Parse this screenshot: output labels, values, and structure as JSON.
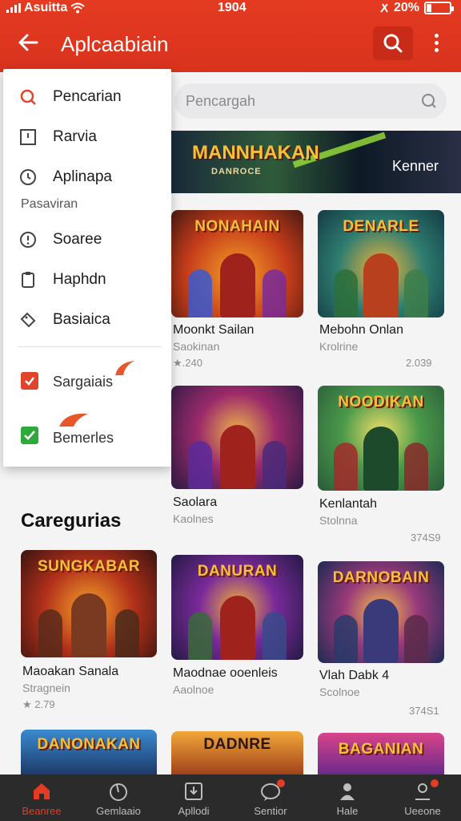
{
  "status": {
    "carrier": "Asuitta",
    "time": "1904",
    "battery": "20%",
    "battery_level": 0.2
  },
  "appbar": {
    "title": "Aplcaabiain"
  },
  "search": {
    "placeholder": "Pencargah"
  },
  "banner": {
    "title": "MANNHAKAN",
    "subtitle": "DANROCE",
    "tag": "Kenner"
  },
  "menu": {
    "items": [
      {
        "label": "Pencarian",
        "icon": "search-icon"
      },
      {
        "label": "Rarvia",
        "icon": "window-icon"
      },
      {
        "label": "Aplinapa",
        "icon": "clock-icon"
      },
      {
        "label": "Soaree",
        "icon": "info-icon"
      },
      {
        "label": "Haphdn",
        "icon": "clipboard-icon"
      },
      {
        "label": "Basiaica",
        "icon": "tag-icon"
      }
    ],
    "header": "Pasaviran",
    "checks": [
      {
        "label": "Sargaiais",
        "checked": false,
        "color": "#e0452c"
      },
      {
        "label": "Bemerles",
        "checked": true,
        "color": "#2eaa3c"
      }
    ]
  },
  "games_row1": [
    {
      "title": "NONAHAIN",
      "name": "Moonkt Sailan",
      "sub": "Saokinan",
      "rating": "★.240",
      "side": ""
    },
    {
      "title": "DENARLE",
      "name": "Mebohn Onlan",
      "sub": "Krolrine",
      "rating": "",
      "side": "2.039"
    }
  ],
  "games_row2": [
    {
      "title": "",
      "name": "Saolara",
      "sub": "Kaolnes",
      "rating": "",
      "side": ""
    },
    {
      "title": "NOODIKAN",
      "name": "Kenlantah",
      "sub": "Stolnna",
      "rating": "",
      "side": "374S9"
    }
  ],
  "categories": {
    "title": "Caregurias",
    "items": [
      {
        "title": "SUNGKABAR",
        "name": "Maoakan Sanala",
        "sub": "Stragnein",
        "rating": "★ 2.79",
        "side": ""
      },
      {
        "title": "DANURAN",
        "name": "Maodnae ooenleis",
        "sub": "Aaolnoe",
        "rating": "",
        "side": ""
      },
      {
        "title": "DARNOBAIN",
        "name": "Vlah Dabk 4",
        "sub": "Scolnoe",
        "rating": "",
        "side": "374S1"
      }
    ]
  },
  "row4_titles": [
    "DANONAKAN",
    "DADNRE",
    "BAGANIAN"
  ],
  "bottom_nav": [
    {
      "label": "Beanree",
      "icon": "home-icon",
      "active": true
    },
    {
      "label": "Gemlaaio",
      "icon": "timer-icon",
      "active": false
    },
    {
      "label": "Apllodi",
      "icon": "download-box-icon",
      "active": false
    },
    {
      "label": "Sentior",
      "icon": "chat-icon",
      "active": false
    },
    {
      "label": "Hale",
      "icon": "profile-icon",
      "active": false
    },
    {
      "label": "Ueeone",
      "icon": "user-icon",
      "active": false
    }
  ],
  "colors": {
    "accent": "#e43a22",
    "nav_bg": "#2b2b2b",
    "title_gold": "#f6c03c"
  }
}
